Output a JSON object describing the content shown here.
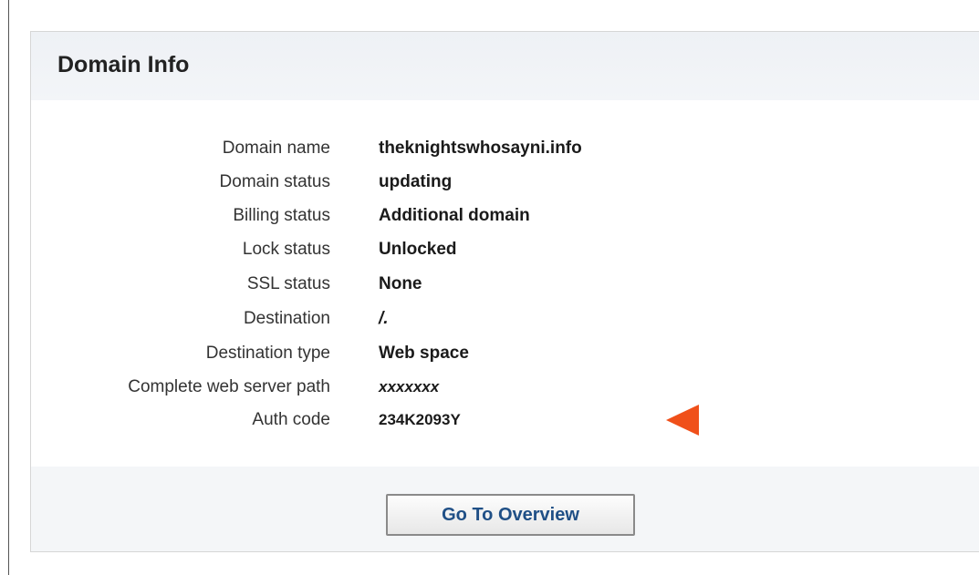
{
  "panel": {
    "title": "Domain Info"
  },
  "rows": [
    {
      "label": "Domain name",
      "value": "theknightswhosayni.info"
    },
    {
      "label": "Domain status",
      "value": "updating"
    },
    {
      "label": "Billing status",
      "value": "Additional domain"
    },
    {
      "label": "Lock status",
      "value": "Unlocked"
    },
    {
      "label": "SSL status",
      "value": "None"
    },
    {
      "label": "Destination",
      "value": "/."
    },
    {
      "label": "Destination type",
      "value": "Web space"
    },
    {
      "label": "Complete web server path",
      "value": "xxxxxxx"
    },
    {
      "label": "Auth code",
      "value": "234K2093Y"
    }
  ],
  "footer": {
    "overview_button_label": "Go To Overview"
  },
  "annotation": {
    "arrow_color": "#f0501a",
    "arrow_icon": "left-pointing-triangle"
  }
}
